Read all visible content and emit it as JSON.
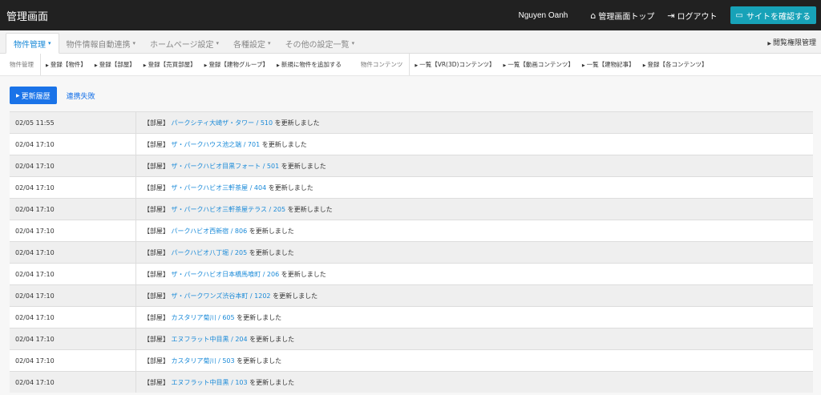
{
  "header": {
    "title": "管理画面",
    "user": "Nguyen Oanh",
    "admin_top": "管理画面トップ",
    "logout": "ログアウト",
    "view_site": "サイトを確認する"
  },
  "menu": {
    "items": [
      {
        "label": "物件管理"
      },
      {
        "label": "物件情報自動連携"
      },
      {
        "label": "ホームページ設定"
      },
      {
        "label": "各種設定"
      },
      {
        "label": "その他の設定一覧"
      }
    ],
    "right": "閲覧権限管理"
  },
  "submenu": {
    "group1_label": "物件管理",
    "group1": [
      "登録【物件】",
      "登録【部屋】",
      "登録【売買部屋】",
      "登録【建物グループ】",
      "新規に物件を追加する"
    ],
    "group2_label": "物件コンテンツ",
    "group2": [
      "一覧【VR(3D)コンテンツ】",
      "一覧【動画コンテンツ】",
      "一覧【建物記事】",
      "登録【各コンテンツ】"
    ]
  },
  "tabs": {
    "active": "更新履歴",
    "other": "連携失敗"
  },
  "log": {
    "rows": [
      {
        "time": "02/05 11:55",
        "prefix": "【部屋】",
        "target": "パークシティ大崎ザ・タワー / 510",
        "suffix": "を更新しました"
      },
      {
        "time": "02/04 17:10",
        "prefix": "【部屋】",
        "target": "ザ・パークハウス池之端 / 701",
        "suffix": "を更新しました"
      },
      {
        "time": "02/04 17:10",
        "prefix": "【部屋】",
        "target": "ザ・パークハビオ目黒フォート / 501",
        "suffix": "を更新しました"
      },
      {
        "time": "02/04 17:10",
        "prefix": "【部屋】",
        "target": "ザ・パークハビオ三軒茶屋 / 404",
        "suffix": "を更新しました"
      },
      {
        "time": "02/04 17:10",
        "prefix": "【部屋】",
        "target": "ザ・パークハビオ三軒茶屋テラス / 205",
        "suffix": "を更新しました"
      },
      {
        "time": "02/04 17:10",
        "prefix": "【部屋】",
        "target": "パークハビオ西新宿 / 806",
        "suffix": "を更新しました"
      },
      {
        "time": "02/04 17:10",
        "prefix": "【部屋】",
        "target": "パークハビオ八丁堀 / 205",
        "suffix": "を更新しました"
      },
      {
        "time": "02/04 17:10",
        "prefix": "【部屋】",
        "target": "ザ・パークハビオ日本橋馬喰町 / 206",
        "suffix": "を更新しました"
      },
      {
        "time": "02/04 17:10",
        "prefix": "【部屋】",
        "target": "ザ・パークワンズ渋谷本町 / 1202",
        "suffix": "を更新しました"
      },
      {
        "time": "02/04 17:10",
        "prefix": "【部屋】",
        "target": "カスタリア菊川 / 605",
        "suffix": "を更新しました"
      },
      {
        "time": "02/04 17:10",
        "prefix": "【部屋】",
        "target": "エヌフラット中目黒 / 204",
        "suffix": "を更新しました"
      },
      {
        "time": "02/04 17:10",
        "prefix": "【部屋】",
        "target": "カスタリア菊川 / 503",
        "suffix": "を更新しました"
      },
      {
        "time": "02/04 17:10",
        "prefix": "【部屋】",
        "target": "エヌフラット中目黒 / 103",
        "suffix": "を更新しました"
      }
    ]
  }
}
